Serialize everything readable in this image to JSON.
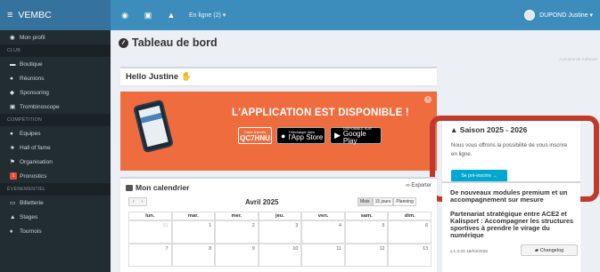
{
  "brand": {
    "hamburger": "≡",
    "name": "VEMBC"
  },
  "sidebar": {
    "items": [
      {
        "type": "item",
        "icon": "user-icon",
        "glyph": "◉",
        "label": "Mon profil"
      },
      {
        "type": "header",
        "label": "CLUB"
      },
      {
        "type": "item",
        "icon": "cart-icon",
        "glyph": "▬",
        "label": "Boutique"
      },
      {
        "type": "item",
        "icon": "users-icon",
        "glyph": "●",
        "label": "Réunions"
      },
      {
        "type": "item",
        "icon": "handshake-icon",
        "glyph": "◆",
        "label": "Sponsoring"
      },
      {
        "type": "item",
        "icon": "image-icon",
        "glyph": "▣",
        "label": "Trombinoscope"
      },
      {
        "type": "header",
        "label": "COMPÉTITION"
      },
      {
        "type": "item",
        "icon": "teams-icon",
        "glyph": "●",
        "label": "Equipes"
      },
      {
        "type": "item",
        "icon": "star-icon",
        "glyph": "★",
        "label": "Hall of fame"
      },
      {
        "type": "item",
        "icon": "flag-icon",
        "glyph": "⚑",
        "label": "Organisation"
      },
      {
        "type": "item",
        "icon": "pronostics-icon",
        "glyph": "1",
        "label": "Pronostics",
        "red": true
      },
      {
        "type": "header",
        "label": "ÉVÉNEMENTIEL"
      },
      {
        "type": "item",
        "icon": "ticket-icon",
        "glyph": "▭",
        "label": "Billetterie"
      },
      {
        "type": "item",
        "icon": "graduation-icon",
        "glyph": "▲",
        "label": "Stages"
      },
      {
        "type": "item",
        "icon": "trophy-icon",
        "glyph": "♦",
        "label": "Tournois"
      }
    ]
  },
  "topbar": {
    "dashboard_glyph": "◉",
    "inbox_glyph": "▣",
    "bell_glyph": "▲",
    "online": "En ligne (2) ▾",
    "user": "DUPOND Justine ▾"
  },
  "page": {
    "title": "Tableau de bord",
    "kalisport": "A propos de Kalisport",
    "greeting": "Hello Justine",
    "wave": "✋"
  },
  "banner": {
    "headline": "L'APPLICATION EST DISPONIBLE !",
    "code_label": "Code d'accès",
    "code": "QC7HNU",
    "appstore_small": "Télécharger dans",
    "appstore_big": "l'App Store",
    "gplay_small": "DISPONIBLE SUR",
    "gplay_big": "Google Play",
    "close": "×"
  },
  "season": {
    "title": "Saison 2025 - 2026",
    "text": "Nous vous offrons la possibilité de vous inscrire en ligne.",
    "button": "Se pré-inscrire →"
  },
  "news": {
    "items": [
      "De nouveaux modules premium et un accompagnement sur mesure",
      "Partenariat stratégique entre ACE2 et Kalisport : Accompagner les structures sportives à prendre le virage du numérique"
    ],
    "version": "v.1.3.33 18/04/2025",
    "changelog": "Changelog"
  },
  "calendar": {
    "title": "Mon calendrier",
    "export": "Exporter",
    "nav": [
      "‹",
      "›"
    ],
    "month": "Avril 2025",
    "views": [
      "Mois",
      "15 jours",
      "Planning"
    ],
    "daynames": [
      "lun.",
      "mar.",
      "mer.",
      "jeu.",
      "ven.",
      "sam.",
      "dim."
    ],
    "weeks": [
      [
        {
          "d": "31",
          "other": true
        },
        {
          "d": "1"
        },
        {
          "d": "2"
        },
        {
          "d": "3"
        },
        {
          "d": "4"
        },
        {
          "d": "5"
        },
        {
          "d": "6"
        }
      ],
      [
        {
          "d": "7"
        },
        {
          "d": "8"
        },
        {
          "d": "9"
        },
        {
          "d": "10"
        },
        {
          "d": "11"
        },
        {
          "d": "12"
        },
        {
          "d": "13"
        }
      ]
    ]
  }
}
